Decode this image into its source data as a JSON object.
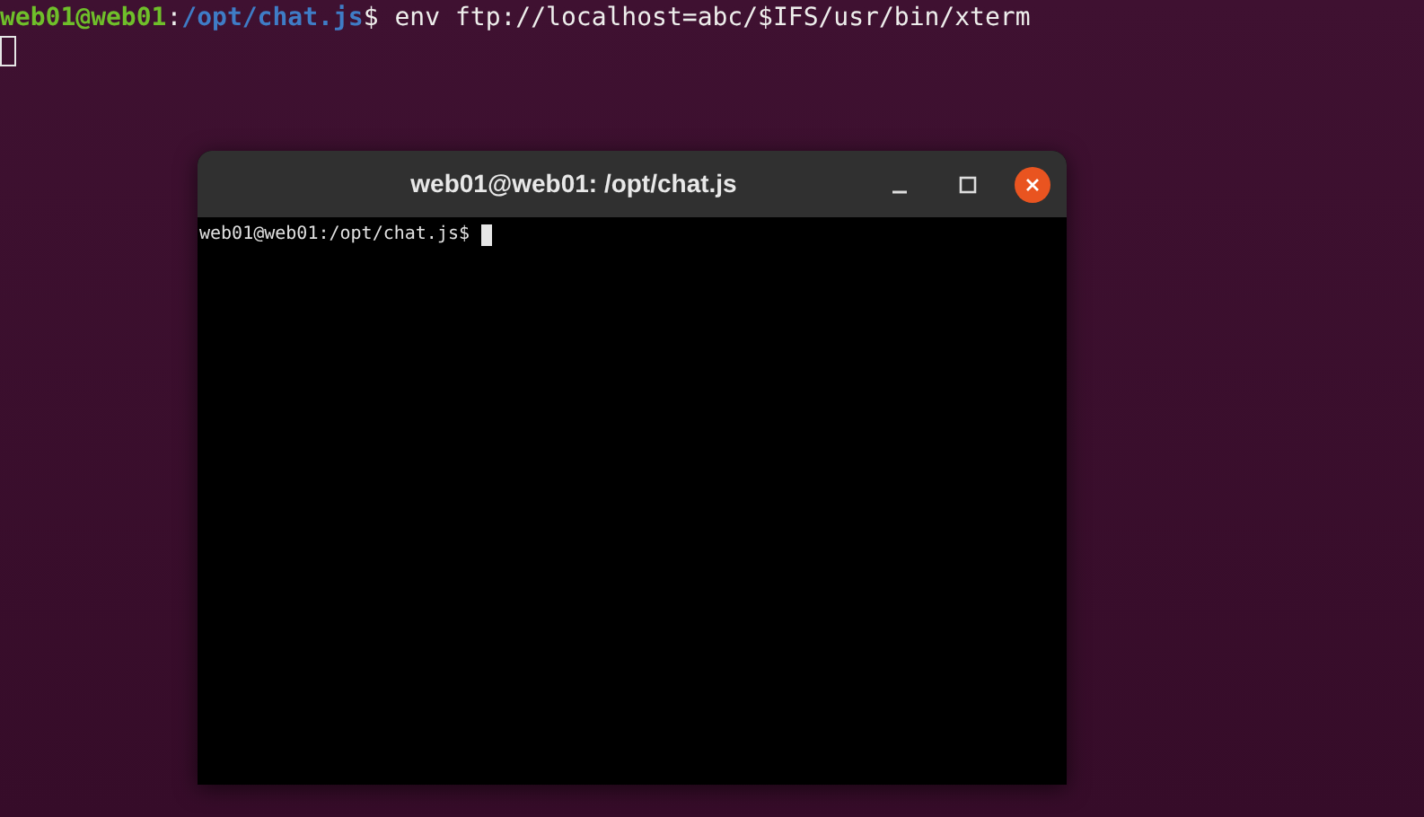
{
  "terminal": {
    "prompt": {
      "user_host": "web01@web01",
      "separator": ":",
      "path": "/opt/chat.js",
      "symbol": "$"
    },
    "command": "env ftp://localhost=abc/$IFS/usr/bin/xterm",
    "cursor": {
      "focused": false
    }
  },
  "xterm_window": {
    "title": "web01@web01: /opt/chat.js",
    "prompt": "web01@web01:/opt/chat.js$",
    "cursor": {
      "focused": true
    }
  }
}
